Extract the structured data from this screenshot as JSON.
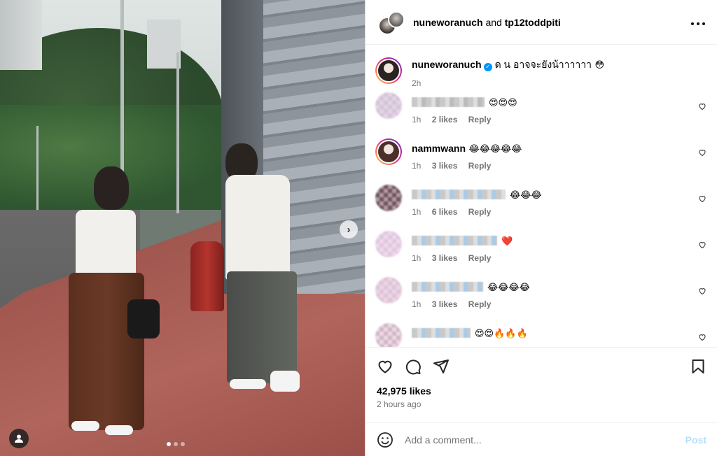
{
  "header": {
    "user1": "nuneworanuch",
    "joiner": "and",
    "user2": "tp12toddpiti",
    "more_icon": "more-horizontal-icon"
  },
  "caption": {
    "username": "nuneworanuch",
    "verified": true,
    "text": "ด น อาจจะยังน้าาาาาา",
    "emoji": "😳",
    "time": "2h"
  },
  "comments": [
    {
      "username_visible": false,
      "emoji": "😍😍😍",
      "time": "1h",
      "likes": "2 likes",
      "reply": "Reply"
    },
    {
      "username": "nammwann",
      "emoji": "😂😂😂😂😂",
      "time": "1h",
      "likes": "3 likes",
      "reply": "Reply"
    },
    {
      "username_visible": false,
      "emoji": "😂😂😂",
      "time": "1h",
      "likes": "6 likes",
      "reply": "Reply"
    },
    {
      "username_visible": false,
      "emoji": "❤️",
      "time": "1h",
      "likes": "3 likes",
      "reply": "Reply"
    },
    {
      "username_visible": false,
      "emoji": "😂😂😂😂",
      "time": "1h",
      "likes": "3 likes",
      "reply": "Reply"
    },
    {
      "username_visible": false,
      "emoji": "😍😍🔥🔥🔥",
      "time": "",
      "likes": "",
      "reply": ""
    }
  ],
  "actions": {
    "likes": "42,975 likes",
    "time_ago": "2 hours ago"
  },
  "add_comment": {
    "placeholder": "Add a comment...",
    "post_label": "Post"
  },
  "carousel": {
    "next_symbol": "›",
    "dots": 3,
    "active_index": 0
  },
  "colors": {
    "accent": "#0095f6",
    "post_disabled": "#b2dffc",
    "meta": "#737373"
  }
}
